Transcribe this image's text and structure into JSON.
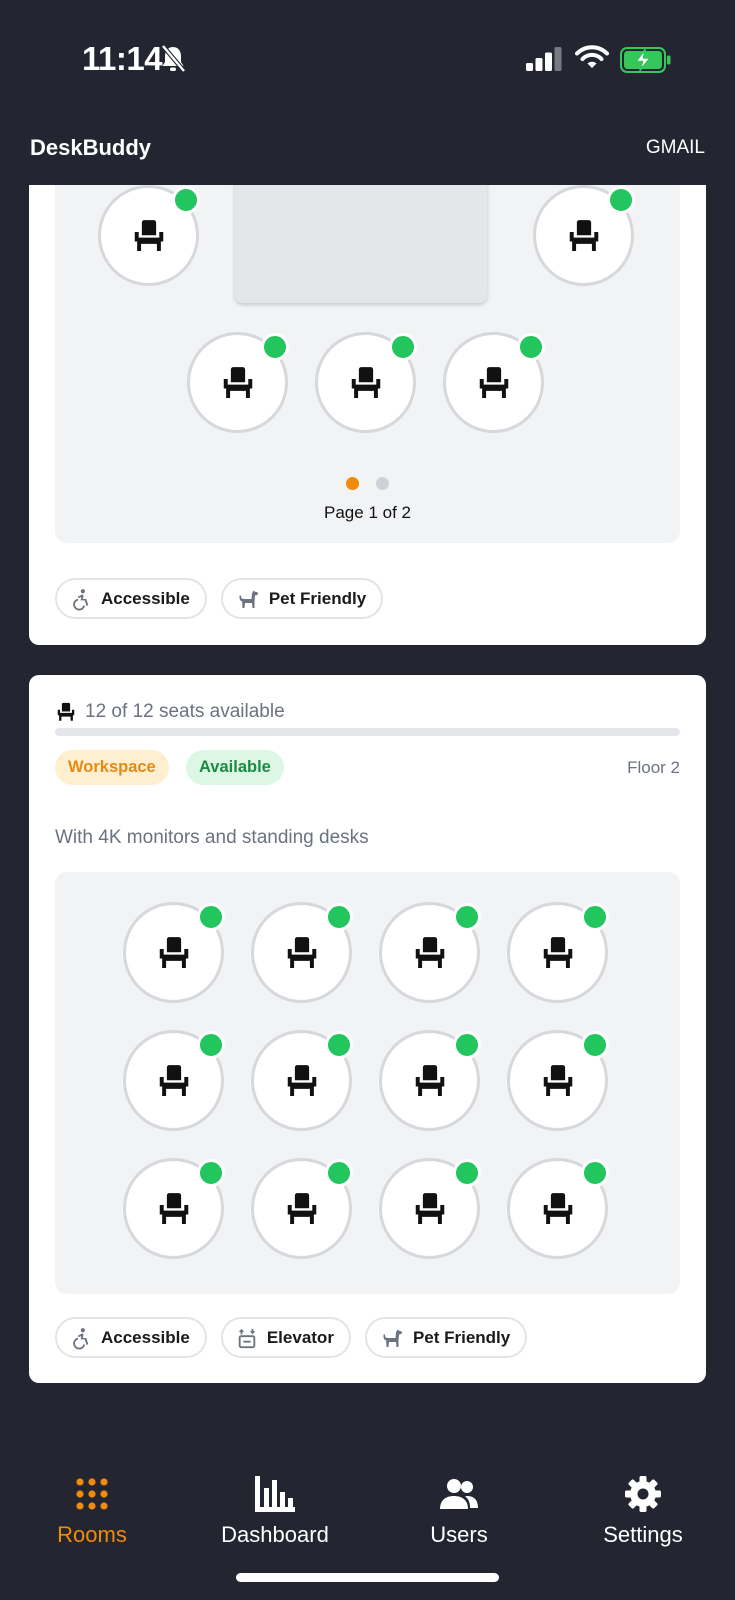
{
  "status_bar": {
    "time": "11:14",
    "icons": [
      "bell-slash-icon",
      "signal-icon",
      "wifi-icon",
      "battery-charging-icon"
    ]
  },
  "header": {
    "title": "DeskBuddy",
    "account": "GMAIL"
  },
  "colors": {
    "background": "#232630",
    "accent": "#f08a0c",
    "available": "#22c55e"
  },
  "room1": {
    "seat_status": [
      "available",
      "available",
      "available",
      "available",
      "available"
    ],
    "page_label": "Page 1 of 2",
    "page_index": 1,
    "page_count": 2,
    "amenities": [
      {
        "label": "Accessible",
        "icon": "accessible-icon"
      },
      {
        "label": "Pet Friendly",
        "icon": "pet-icon"
      }
    ]
  },
  "room2": {
    "seats_text": "12 of 12 seats available",
    "seats_available": 12,
    "seats_total": 12,
    "type_tag": "Workspace",
    "status_tag": "Available",
    "floor": "Floor 2",
    "description": "With 4K monitors and standing desks",
    "seat_status": [
      "available",
      "available",
      "available",
      "available",
      "available",
      "available",
      "available",
      "available",
      "available",
      "available",
      "available",
      "available"
    ],
    "amenities": [
      {
        "label": "Accessible",
        "icon": "accessible-icon"
      },
      {
        "label": "Elevator",
        "icon": "elevator-icon"
      },
      {
        "label": "Pet Friendly",
        "icon": "pet-icon"
      }
    ]
  },
  "tabs": [
    {
      "label": "Rooms",
      "icon": "grid-dots-icon",
      "active": true
    },
    {
      "label": "Dashboard",
      "icon": "bar-chart-icon",
      "active": false
    },
    {
      "label": "Users",
      "icon": "users-icon",
      "active": false
    },
    {
      "label": "Settings",
      "icon": "gear-icon",
      "active": false
    }
  ]
}
